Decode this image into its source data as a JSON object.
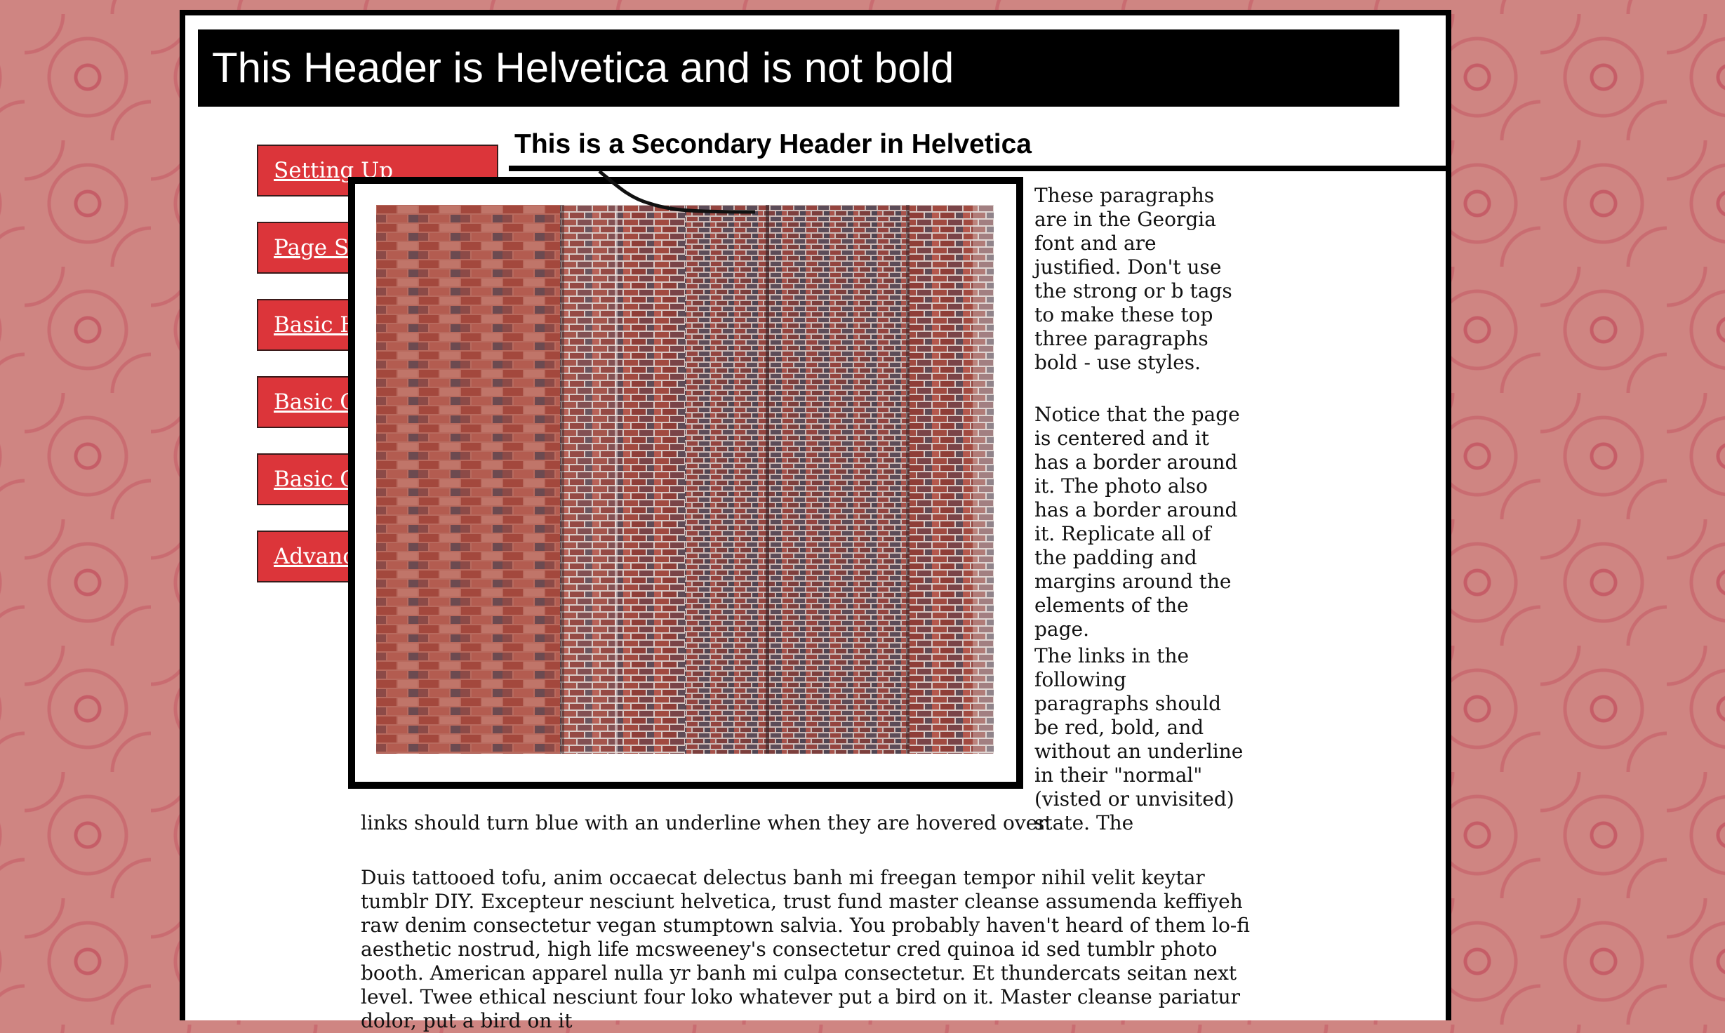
{
  "header": {
    "title": "This Header is Helvetica and is not bold"
  },
  "nav": {
    "items": [
      {
        "label": "Setting Up"
      },
      {
        "label": "Page Structure"
      },
      {
        "label": "Basic HTML"
      },
      {
        "label": "Basic CSS"
      },
      {
        "label": "Basic CSS 2"
      },
      {
        "label": "Advanced CSS"
      }
    ]
  },
  "content": {
    "secondary_header": "This is a Secondary Header in Helvetica",
    "paragraphs": [
      "These paragraphs are in the Georgia font and are justified. Don't use the strong or b tags to make these top three paragraphs bold - use styles.",
      "Notice that the page is centered and it has a border around it. The photo also has a border around it. Replicate all of the padding and margins around the elements of the page.",
      "The links in the following paragraphs should be red, bold, and without an underline in their \"normal\" (visted or unvisited) state. The",
      "links should turn blue with an underline when they are hovered over.",
      "Duis tattooed tofu, anim occaecat delectus banh mi freegan tempor nihil velit keytar tumblr DIY. Excepteur nesciunt helvetica, trust fund master cleanse assumenda keffiyeh raw denim consectetur vegan stumptown salvia. You probably haven't heard of them lo-fi aesthetic nostrud, high life mcsweeney's consectetur cred quinoa id sed tumblr photo booth. American apparel nulla yr banh mi culpa consectetur. Et thundercats seitan next level. Twee ethical nesciunt four loko whatever put a bird on it. Master cleanse pariatur dolor, put a bird on it"
    ]
  },
  "colors": {
    "background": "#cf8582",
    "nav_button": "#dc353a",
    "header_bg": "#000000",
    "page_bg": "#ffffff"
  },
  "icons": {
    "photo": "brick-wall-photo"
  }
}
